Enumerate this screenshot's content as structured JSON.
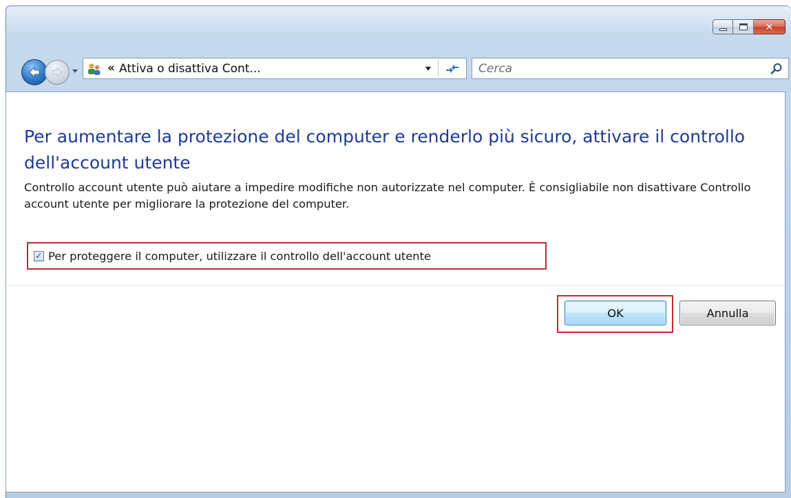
{
  "address_bar": {
    "chevrons": "«",
    "path": "Attiva o disattiva Cont...",
    "icon": "user-accounts-icon"
  },
  "search": {
    "placeholder": "Cerca"
  },
  "content": {
    "title": "Per aumentare la protezione del computer e renderlo più sicuro, attivare il controllo dell'account utente",
    "description": "Controllo account utente può aiutare a impedire modifiche non autorizzate nel computer. È consigliabile non disattivare Controllo account utente per migliorare la protezione del computer.",
    "option": {
      "label": "Per proteggere il computer, utilizzare il controllo dell'account utente",
      "checked": true
    }
  },
  "buttons": {
    "ok": "OK",
    "cancel": "Annulla"
  },
  "colors": {
    "title": "#1e3a96",
    "highlight": "#c8262e"
  }
}
